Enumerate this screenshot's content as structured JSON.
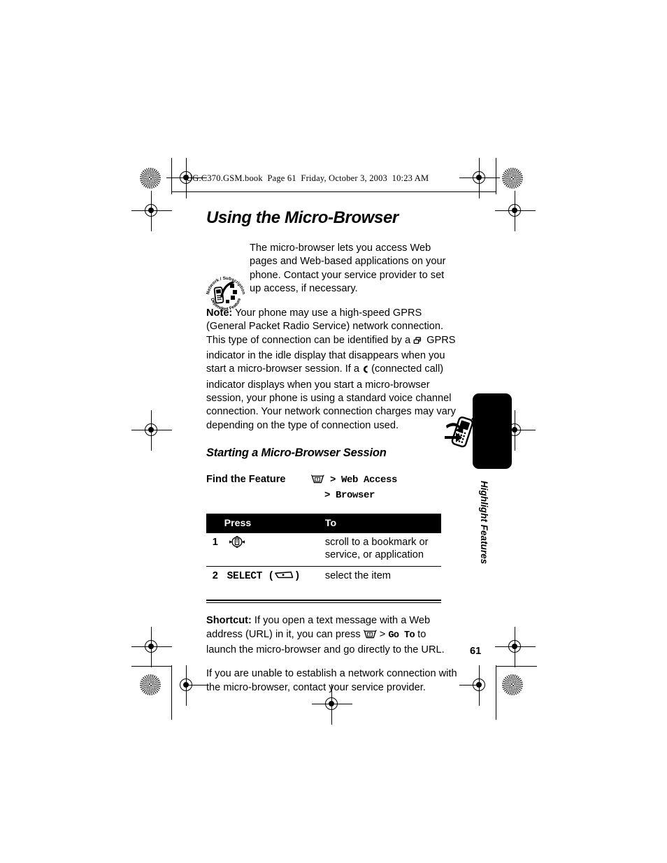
{
  "document": {
    "file_header": "UG.C370.GSM.book  Page 61  Friday, October 3, 2003  10:23 AM",
    "page_number": "61",
    "tab_label": "Highlight Features"
  },
  "heading": {
    "title": "Using the Micro-Browser",
    "subtitle": "Starting a Micro-Browser Session"
  },
  "intro": {
    "badge_top_text": "Network / Subscription",
    "badge_bottom_text": "Dependent Feature",
    "text": "The micro-browser lets you access Web pages and Web-based applications on your phone. Contact your service provider to set up access, if necessary."
  },
  "note": {
    "label": "Note:",
    "part1": " Your phone may use a high-speed GPRS (General Packet Radio Service) network connection. This type of connection can be identified by a ",
    "gprs_icon": "gprs-indicator-icon",
    "part2": " GPRS indicator in the idle display that disappears when you start a micro-browser session. If a ",
    "call_icon": "connected-call-icon",
    "part3": " (connected call) indicator displays when you start a micro-browser session, your phone is using a standard voice channel connection. Your network connection charges may vary depending on the type of connection used."
  },
  "find_feature": {
    "label": "Find the Feature",
    "menu_icon": "menu-key-icon",
    "path_line1": "> Web Access",
    "path_line2": "> Browser"
  },
  "steps_table": {
    "headers": {
      "number": "",
      "press": "Press",
      "to": "To"
    },
    "rows": [
      {
        "number": "1",
        "press_icon": "navigation-key-icon",
        "press_text": "",
        "to": "scroll to a bookmark or service, or application"
      },
      {
        "number": "2",
        "press_icon": "soft-key-icon",
        "press_text": "SELECT",
        "to": "select the item"
      }
    ]
  },
  "shortcut": {
    "label": "Shortcut:",
    "part1": " If you open a text message with a Web address (URL) in it, you can press ",
    "menu_icon": "menu-key-icon",
    "part2": " > ",
    "command": "Go To",
    "part3": " to launch the micro-browser and go directly to the URL."
  },
  "closing": {
    "text": "If you are unable to establish a network connection with the micro-browser, contact your service provider."
  },
  "colors": {
    "page_background": "#ffffff",
    "text": "#000000",
    "table_header_background": "#000000",
    "table_header_text": "#ffffff",
    "tab_background": "#000000"
  }
}
